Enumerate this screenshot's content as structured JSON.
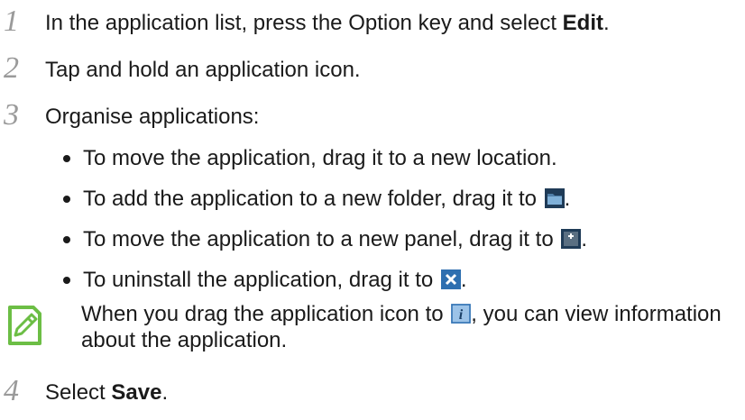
{
  "steps": [
    {
      "num": "1",
      "text_before": "In the application list, press the Option key and select ",
      "text_bold": "Edit",
      "text_after": "."
    },
    {
      "num": "2",
      "text": "Tap and hold an application icon."
    },
    {
      "num": "3",
      "text": "Organise applications:"
    },
    {
      "num": "4",
      "text_before": "Select ",
      "text_bold": "Save",
      "text_after": "."
    }
  ],
  "bullets": [
    {
      "text": "To move the application, drag it to a new location."
    },
    {
      "text": "To add the application to a new folder, drag it to ",
      "icon": "folder-icon",
      "after": "."
    },
    {
      "text": "To move the application to a new panel, drag it to ",
      "icon": "new-panel-icon",
      "after": "."
    },
    {
      "text": "To uninstall the application, drag it to ",
      "icon": "uninstall-icon",
      "after": "."
    }
  ],
  "note": {
    "icon": "note-pencil-icon",
    "text_before": "When you drag the application icon to ",
    "icon_inline": "info-icon",
    "text_after": ", you can view information about the application."
  },
  "colors": {
    "accent_green": "#6cbe45",
    "icon_blue": "#4a8ac4"
  }
}
